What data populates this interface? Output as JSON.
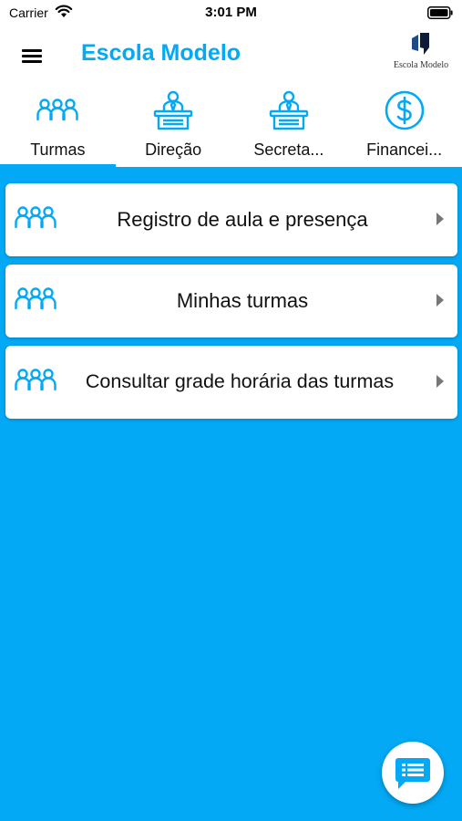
{
  "status_bar": {
    "carrier": "Carrier",
    "time": "3:01 PM",
    "wifi_icon": "wifi-icon",
    "battery_icon": "battery-icon"
  },
  "header": {
    "title": "Escola Modelo",
    "menu_icon": "hamburger-menu-icon",
    "logo_text": "Escola Modelo"
  },
  "tabs": [
    {
      "label": "Turmas",
      "icon": "people-group-icon",
      "selected": true
    },
    {
      "label": "Direção",
      "icon": "podium-speaker-icon",
      "selected": false
    },
    {
      "label": "Secreta...",
      "icon": "podium-speaker-icon",
      "selected": false
    },
    {
      "label": "Financei...",
      "icon": "dollar-circle-icon",
      "selected": false
    }
  ],
  "menu_items": [
    {
      "label": "Registro de aula e presença",
      "icon": "people-group-icon"
    },
    {
      "label": "Minhas turmas",
      "icon": "people-group-icon"
    },
    {
      "label": "Consultar grade horária das turmas",
      "icon": "people-group-icon"
    }
  ],
  "fab": {
    "icon": "chat-list-icon"
  },
  "colors": {
    "accent": "#03a9f4",
    "background": "#03a9f4",
    "card": "#ffffff",
    "text": "#111111"
  }
}
